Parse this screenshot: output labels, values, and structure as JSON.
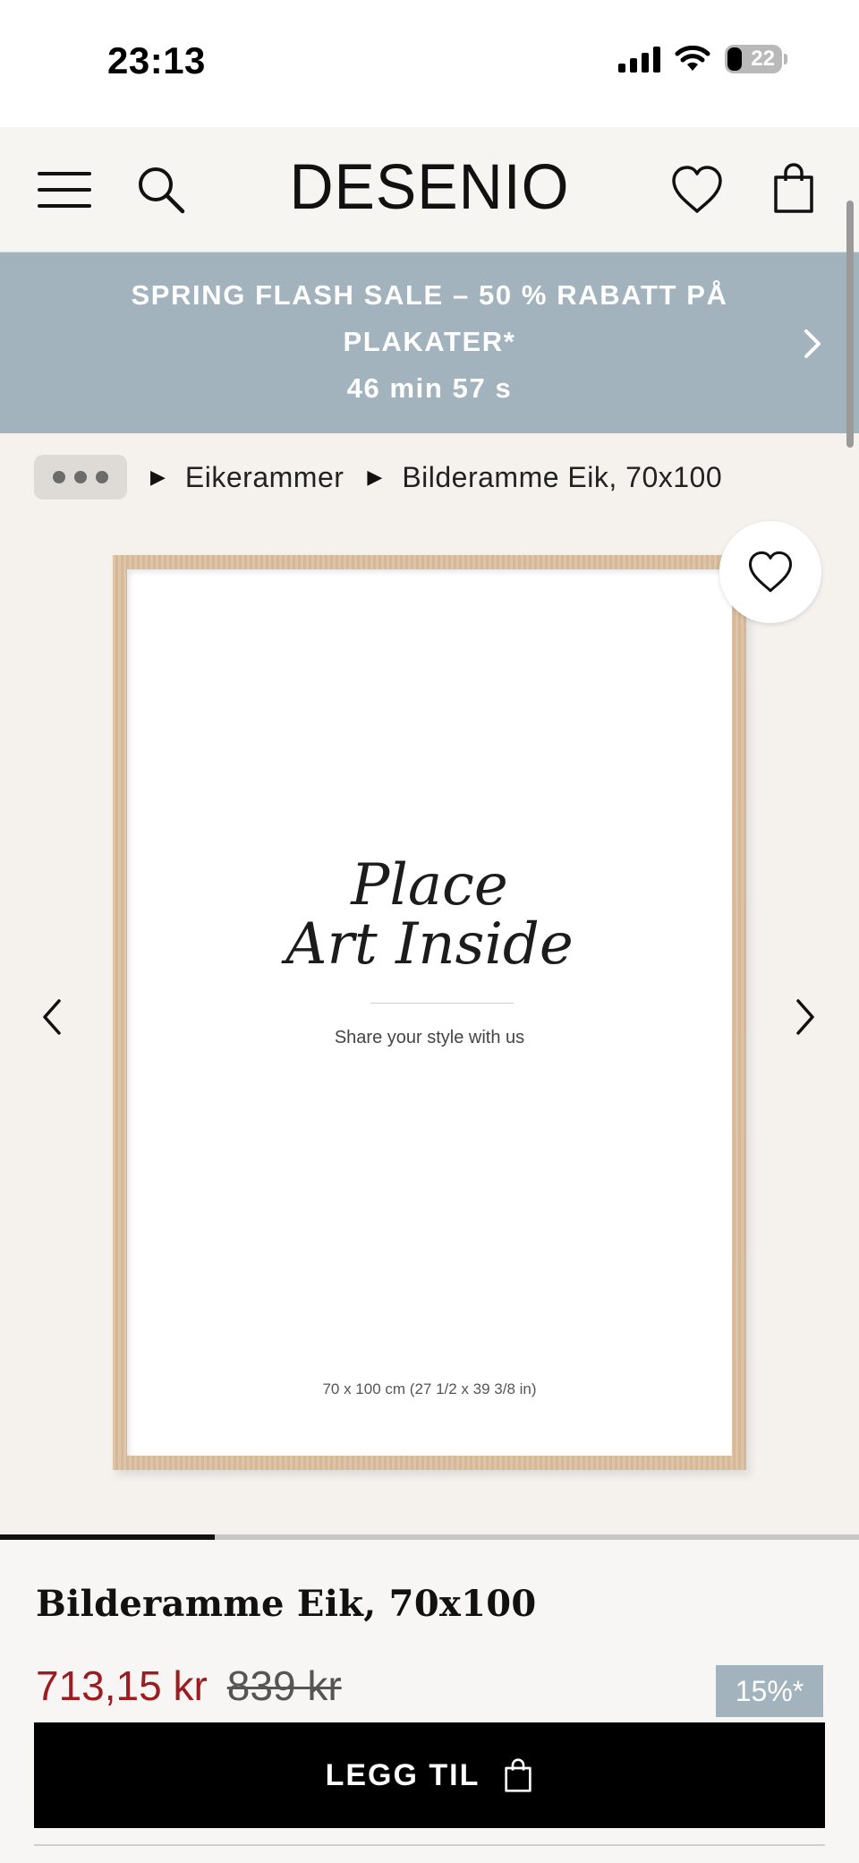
{
  "status_bar": {
    "time": "23:13",
    "battery": "22"
  },
  "header": {
    "logo": "DESENIO"
  },
  "promo": {
    "title": "SPRING FLASH SALE – 50 % RABATT PÅ PLAKATER*",
    "timer": "46 min 57 s"
  },
  "breadcrumb": {
    "items": [
      "Eikerammer",
      "Bilderamme Eik, 70x100"
    ]
  },
  "gallery": {
    "art_title_line1": "Place",
    "art_title_line2": "Art Inside",
    "art_subtitle": "Share your style with us",
    "art_size": "70 x 100 cm  (27 1/2 x 39 3/8 in)",
    "progress_fraction": 0.25
  },
  "product": {
    "title": "Bilderamme Eik, 70x100",
    "price": "713,15 kr",
    "old_price": "839 kr",
    "discount": "15%*",
    "add_button": "LEGG TIL"
  },
  "colors": {
    "promo": "#a3b3be",
    "sale_price": "#9c1c22",
    "background": "#f5f2ee",
    "button": "#000000"
  },
  "icons": [
    "menu-icon",
    "search-icon",
    "heart-icon",
    "bag-icon",
    "chevron-right-icon",
    "chevron-left-icon",
    "more-icon",
    "triangle-right-icon"
  ]
}
